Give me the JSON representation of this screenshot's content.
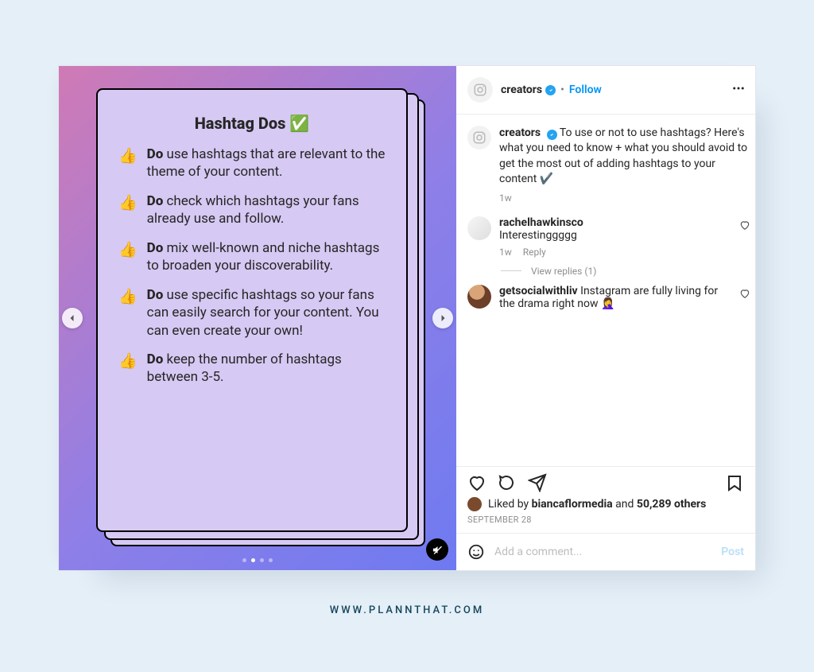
{
  "media": {
    "title": "Hashtag Dos ✅",
    "emoji": "👍",
    "do_word": "Do",
    "tips": [
      "use hashtags that are relevant to the theme of your content.",
      "check which hashtags your fans already use and follow.",
      "mix well-known and niche hashtags to broaden your discoverability.",
      "use specific hashtags so your fans can easily search for your content. You can even create your own!",
      "keep the number of hashtags between 3-5."
    ],
    "carousel": {
      "count": 4,
      "index": 1
    }
  },
  "header": {
    "username": "creators",
    "follow": "Follow"
  },
  "caption": {
    "username": "creators",
    "text": "To use or not to use hashtags? Here's what you need to know + what you should avoid to get the most out of adding hashtags to your content ✔️",
    "time": "1w"
  },
  "comments": [
    {
      "username": "rachelhawkinsco",
      "text": "Interestinggggg",
      "time": "1w",
      "reply": "Reply",
      "view_replies": "View replies (1)"
    },
    {
      "username": "getsocialwithliv",
      "text": "Instagram are fully living for the drama right now 🤦‍♀️"
    }
  ],
  "likes": {
    "by": "biancaflormedia",
    "others": "50,289 others",
    "prefix": "Liked by",
    "and": "and"
  },
  "date": "SEPTEMBER 28",
  "comment_box": {
    "placeholder": "Add a comment...",
    "post": "Post"
  },
  "watermark": "WWW.PLANNTHAT.COM"
}
